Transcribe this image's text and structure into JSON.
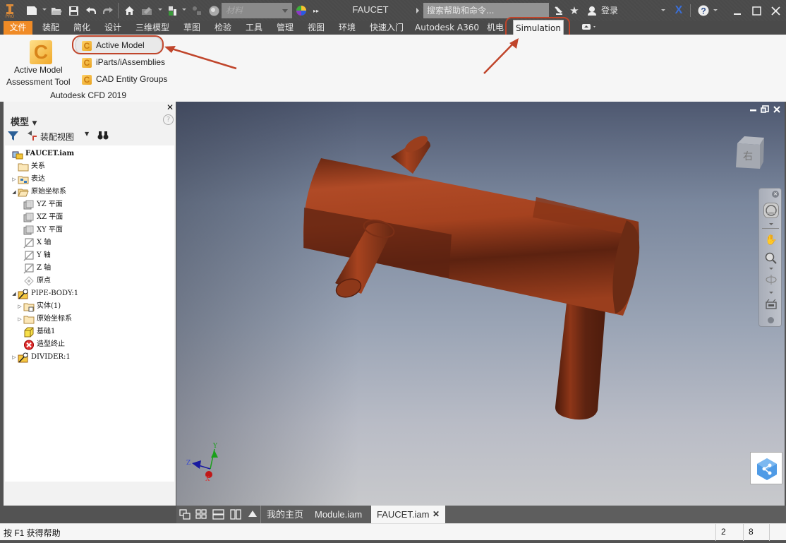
{
  "title_bar": {
    "app_badge": "PRO",
    "app_title": "FAUCET",
    "material_placeholder": "材料",
    "search_placeholder": "搜索帮助和命令...",
    "login_label": "登录",
    "quick_access_icons": [
      "new-icon",
      "open-icon",
      "save-icon",
      "undo-icon",
      "redo-icon",
      "home-icon",
      "appearance-icon",
      "select-icon",
      "adjust-icon",
      "material-sphere-icon",
      "color-wheel-icon",
      "more-icon"
    ],
    "right_icons": [
      "satellite-icon",
      "star-icon",
      "user-icon",
      "autodesk-x-icon",
      "help-icon"
    ],
    "window_controls": [
      "minimize",
      "maximize",
      "close"
    ]
  },
  "ribbon_tabs": [
    {
      "label": "文件",
      "style": "file"
    },
    {
      "label": "装配"
    },
    {
      "label": "简化"
    },
    {
      "label": "设计"
    },
    {
      "label": "三维模型"
    },
    {
      "label": "草图"
    },
    {
      "label": "检验"
    },
    {
      "label": "工具"
    },
    {
      "label": "管理"
    },
    {
      "label": "视图"
    },
    {
      "label": "环境"
    },
    {
      "label": "快速入门"
    },
    {
      "label": "Autodesk A360"
    },
    {
      "label": "机电"
    },
    {
      "label": "Simulation",
      "active": true
    }
  ],
  "ribbon": {
    "big_button": {
      "line1": "Active Model",
      "line2": "Assessment Tool",
      "icon": "C"
    },
    "small_buttons": [
      {
        "label": "Active Model",
        "icon": "C"
      },
      {
        "label": "iParts/iAssemblies",
        "icon": "C"
      },
      {
        "label": "CAD Entity Groups",
        "icon": "C"
      }
    ],
    "panel_label": "Autodesk CFD 2019"
  },
  "annotations": {
    "highlight_color": "#c0452b"
  },
  "browser": {
    "title": "模型",
    "view_label": "装配视图",
    "tree": [
      {
        "label": "FAUCET.iam",
        "level": 0,
        "icon": "assembly-icon",
        "expander": "",
        "bold": true
      },
      {
        "label": "关系",
        "level": 1,
        "icon": "folder-icon",
        "expander": ""
      },
      {
        "label": "表达",
        "level": 1,
        "icon": "representations-icon",
        "expander": "collapsed"
      },
      {
        "label": "原始坐标系",
        "level": 1,
        "icon": "open-folder-icon",
        "expander": "expanded"
      },
      {
        "label": "YZ 平面",
        "level": 2,
        "icon": "plane-icon",
        "expander": ""
      },
      {
        "label": "XZ 平面",
        "level": 2,
        "icon": "plane-icon",
        "expander": ""
      },
      {
        "label": "XY 平面",
        "level": 2,
        "icon": "plane-icon",
        "expander": ""
      },
      {
        "label": "X 轴",
        "level": 2,
        "icon": "axis-icon",
        "expander": ""
      },
      {
        "label": "Y 轴",
        "level": 2,
        "icon": "axis-icon",
        "expander": ""
      },
      {
        "label": "Z 轴",
        "level": 2,
        "icon": "axis-icon",
        "expander": ""
      },
      {
        "label": "原点",
        "level": 2,
        "icon": "point-icon",
        "expander": ""
      },
      {
        "label": "PIPE-BODY:1",
        "level": 1,
        "icon": "part-pin-icon",
        "expander": "expanded"
      },
      {
        "label": "实体(1)",
        "level": 2,
        "icon": "solid-folder-icon",
        "expander": "collapsed"
      },
      {
        "label": "原始坐标系",
        "level": 2,
        "icon": "folder-icon",
        "expander": "collapsed"
      },
      {
        "label": "基础1",
        "level": 2,
        "icon": "base-block-icon",
        "expander": ""
      },
      {
        "label": "造型终止",
        "level": 2,
        "icon": "end-of-part-icon",
        "expander": ""
      },
      {
        "label": "DIVIDER:1",
        "level": 1,
        "icon": "part-pin-icon",
        "expander": "collapsed"
      }
    ]
  },
  "viewport": {
    "viewcube_face": "右",
    "triad": {
      "x": "X",
      "y": "Y",
      "z": "Z"
    },
    "model_color": "#a9451f"
  },
  "doc_tabs": {
    "layout_icons": [
      "cascade-icon",
      "tile-icon",
      "horizontal-icon",
      "vertical-icon",
      "up-arrow-icon"
    ],
    "tabs": [
      {
        "label": "我的主页"
      },
      {
        "label": "Module.iam"
      },
      {
        "label": "FAUCET.iam",
        "active": true,
        "closable": true
      }
    ]
  },
  "status_bar": {
    "help_text": "按 F1 获得帮助",
    "count1": "2",
    "count2": "8"
  }
}
